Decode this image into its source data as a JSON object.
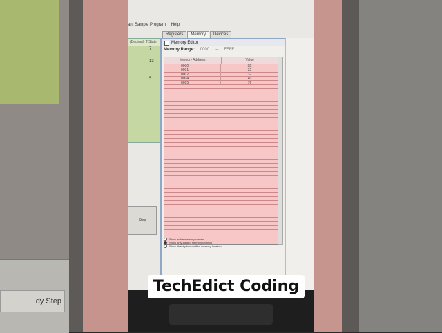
{
  "menubar": {
    "item_program": "ant Sample Program",
    "item_help": "Help"
  },
  "program_panel": {
    "header": "(Decimal)  T-State",
    "cells": [
      "7",
      "13",
      "5"
    ]
  },
  "tabs": [
    {
      "label": "Registers",
      "active": false
    },
    {
      "label": "Memory",
      "active": true
    },
    {
      "label": "Devices",
      "active": false
    }
  ],
  "memory_editor": {
    "title": "Memory Editor",
    "range_label": "Memory Range:",
    "range_start": "0000",
    "range_separator": "---",
    "range_end": "FFFF",
    "columns": {
      "address": "Memory Address",
      "value": "Value"
    },
    "rows": [
      {
        "address": "0000",
        "value": "3E"
      },
      {
        "address": "0001",
        "value": "32"
      },
      {
        "address": "0002",
        "value": "32"
      },
      {
        "address": "0004",
        "value": "40"
      },
      {
        "address": "0005",
        "value": "76"
      }
    ],
    "options": [
      {
        "label": "Show entire memory content",
        "selected": false
      },
      {
        "label": "Show only loaded memory location",
        "selected": true
      },
      {
        "label": "Show directly to specified memory location",
        "selected": false
      }
    ]
  },
  "run_button": {
    "label": "Step"
  },
  "left_dialog_button": {
    "label": "dy Step"
  },
  "caption": "TechEdict Coding",
  "colors": {
    "table_bg": "#f7c7c7",
    "window_border": "#8fa8c8",
    "program_panel": "#c5d8a4"
  }
}
